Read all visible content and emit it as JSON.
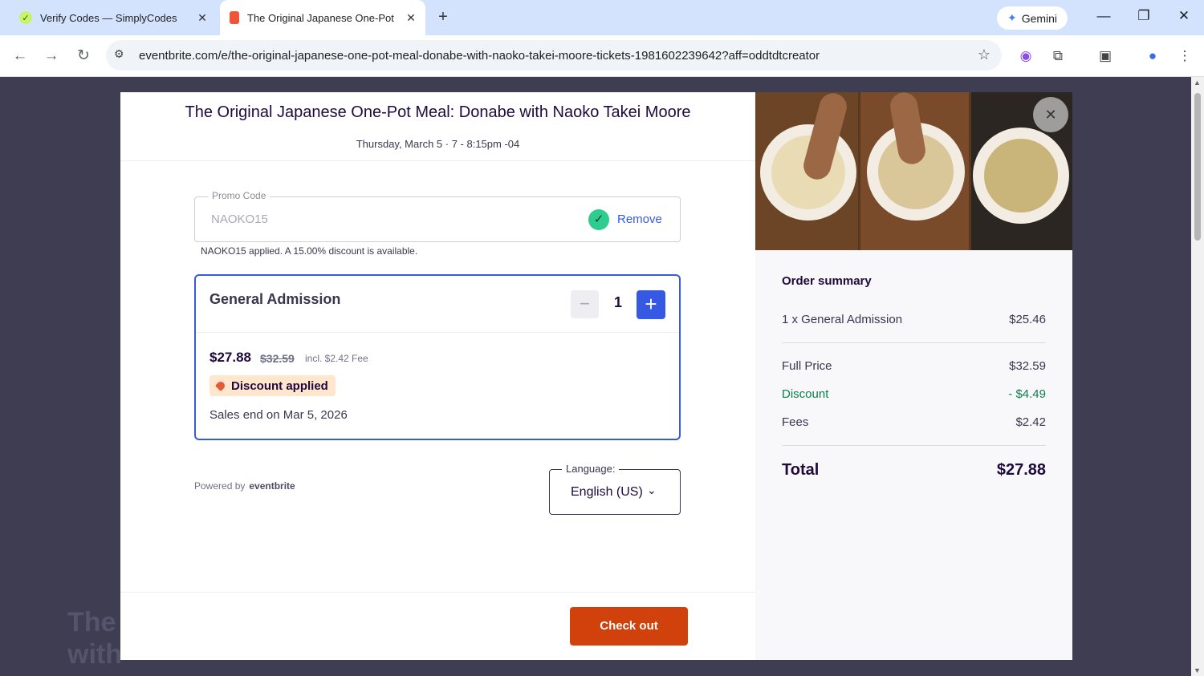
{
  "browser": {
    "tabs": [
      {
        "title": "Verify Codes — SimplyCodes",
        "icon": "simplycodes-icon"
      },
      {
        "title": "The Original Japanese One-Pot",
        "icon": "eventbrite-icon"
      }
    ],
    "new_tab": "+",
    "gemini_label": "Gemini",
    "url": "eventbrite.com/e/the-original-japanese-one-pot-meal-donabe-with-naoko-takei-moore-tickets-1981602239642?aff=oddtdtcreator"
  },
  "background": {
    "title_line1": "The",
    "title_line2": "with"
  },
  "modal": {
    "event_title": "The Original Japanese One-Pot Meal: Donabe with Naoko Takei Moore",
    "event_date": "Thursday, March 5 · 7 - 8:15pm -04",
    "promo": {
      "label": "Promo Code",
      "value": "NAOKO15",
      "remove_label": "Remove",
      "note": "NAOKO15 applied. A 15.00% discount is available."
    },
    "ticket": {
      "name": "General Admission",
      "quantity": "1",
      "minus": "−",
      "plus": "+",
      "price": "$27.88",
      "old_price": "$32.59",
      "fee": "incl. $2.42 Fee",
      "badge": "Discount applied",
      "sales_end": "Sales end on Mar 5, 2026"
    },
    "powered_by": "Powered by",
    "powered_logo": "eventbrite",
    "language": {
      "label": "Language:",
      "value": "English (US)"
    },
    "checkout_label": "Check out"
  },
  "summary": {
    "title": "Order summary",
    "item_label": "1 x General Admission",
    "item_price": "$25.46",
    "full_price_label": "Full Price",
    "full_price": "$32.59",
    "discount_label": "Discount",
    "discount": "- $4.49",
    "fees_label": "Fees",
    "fees": "$2.42",
    "total_label": "Total",
    "total": "$27.88"
  },
  "colors": {
    "accent_blue": "#3659e3",
    "checkout_orange": "#d1410c",
    "discount_green": "#0e7e4a",
    "badge_bg": "#ffe6cc"
  }
}
